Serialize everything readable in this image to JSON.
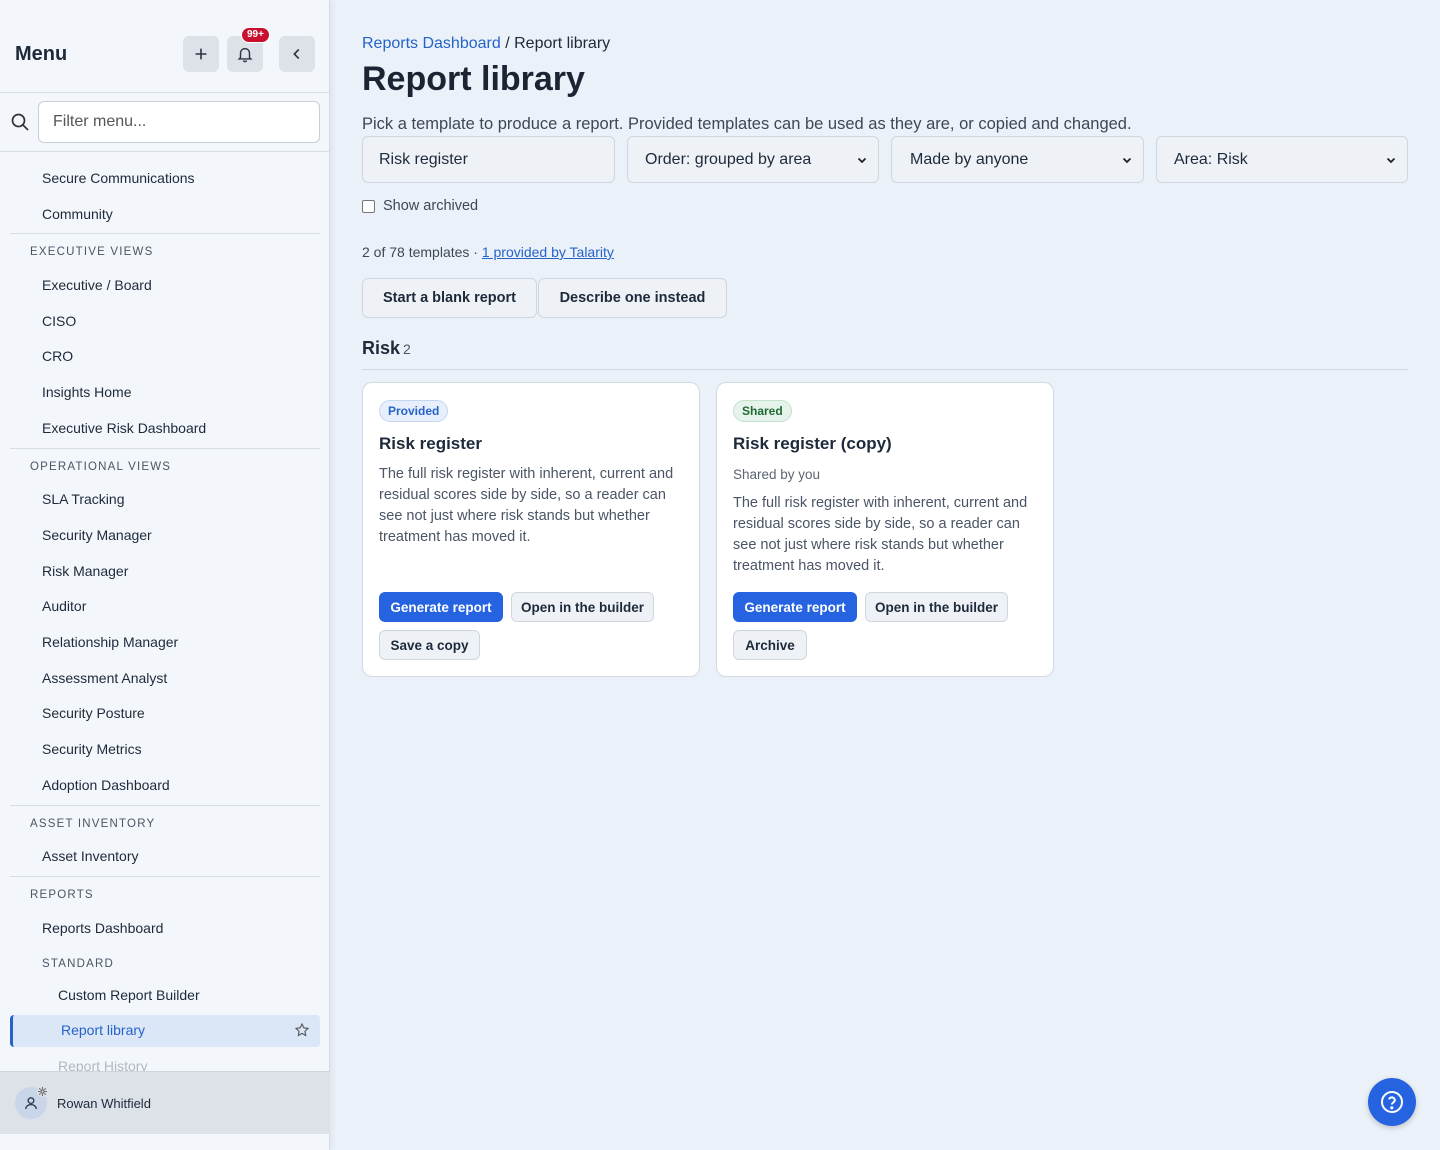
{
  "sidebar": {
    "title": "Menu",
    "notifications_badge": "99+",
    "filter_placeholder": "Filter menu...",
    "items": {
      "secure_comms": "Secure Communications",
      "community": "Community",
      "executive_views": "EXECUTIVE VIEWS",
      "executive_board": "Executive / Board",
      "ciso": "CISO",
      "cro": "CRO",
      "insights_home": "Insights Home",
      "executive_risk_dashboard": "Executive Risk Dashboard",
      "operational_views": "OPERATIONAL VIEWS",
      "sla_tracking": "SLA Tracking",
      "security_manager": "Security Manager",
      "risk_manager": "Risk Manager",
      "auditor": "Auditor",
      "relationship_manager": "Relationship Manager",
      "assessment_analyst": "Assessment Analyst",
      "security_posture": "Security Posture",
      "security_metrics": "Security Metrics",
      "adoption_dashboard": "Adoption Dashboard",
      "asset_inventory_section": "ASSET INVENTORY",
      "asset_inventory": "Asset Inventory",
      "reports_section": "REPORTS",
      "reports_dashboard": "Reports Dashboard",
      "standard_section": "STANDARD",
      "custom_report_builder": "Custom Report Builder",
      "report_library": "Report library",
      "report_history": "Report History"
    },
    "user_name": "Rowan Whitfield"
  },
  "main": {
    "breadcrumb_link": "Reports Dashboard",
    "breadcrumb_sep": "/",
    "breadcrumb_current": "Report library",
    "title": "Report library",
    "subtitle": "Pick a template to produce a report. Provided templates can be used as they are, or copied and changed.",
    "filters": {
      "search_value": "Risk register",
      "order": "Order: grouped by area",
      "made_by": "Made by anyone",
      "area": "Area: Risk"
    },
    "show_archived": "Show archived",
    "count_text": "2 of 78 templates ·",
    "count_link": "1 provided by Talarity",
    "start_blank": "Start a blank report",
    "describe": "Describe one instead",
    "group_name": "Risk",
    "group_count": "2",
    "cards": [
      {
        "tag": "Provided",
        "title": "Risk register",
        "desc": "The full risk register with inherent, current and residual scores side by side, so a reader can see not just where risk stands but whether treatment has moved it.",
        "btn_generate": "Generate report",
        "btn_open": "Open in the builder",
        "btn_third": "Save a copy"
      },
      {
        "tag": "Shared",
        "title": "Risk register (copy)",
        "by": "Shared by you",
        "desc": "The full risk register with inherent, current and residual scores side by side, so a reader can see not just where risk stands but whether treatment has moved it.",
        "btn_generate": "Generate report",
        "btn_open": "Open in the builder",
        "btn_third": "Archive"
      }
    ]
  },
  "icons": {
    "add": "plus-icon",
    "notifications": "bell-icon",
    "collapse": "chevron-left-icon",
    "search": "search-icon",
    "favorite": "star-icon",
    "user": "user-icon",
    "help": "help-icon"
  },
  "colors": {
    "accent": "#2563e0",
    "badge": "#c8102e"
  }
}
